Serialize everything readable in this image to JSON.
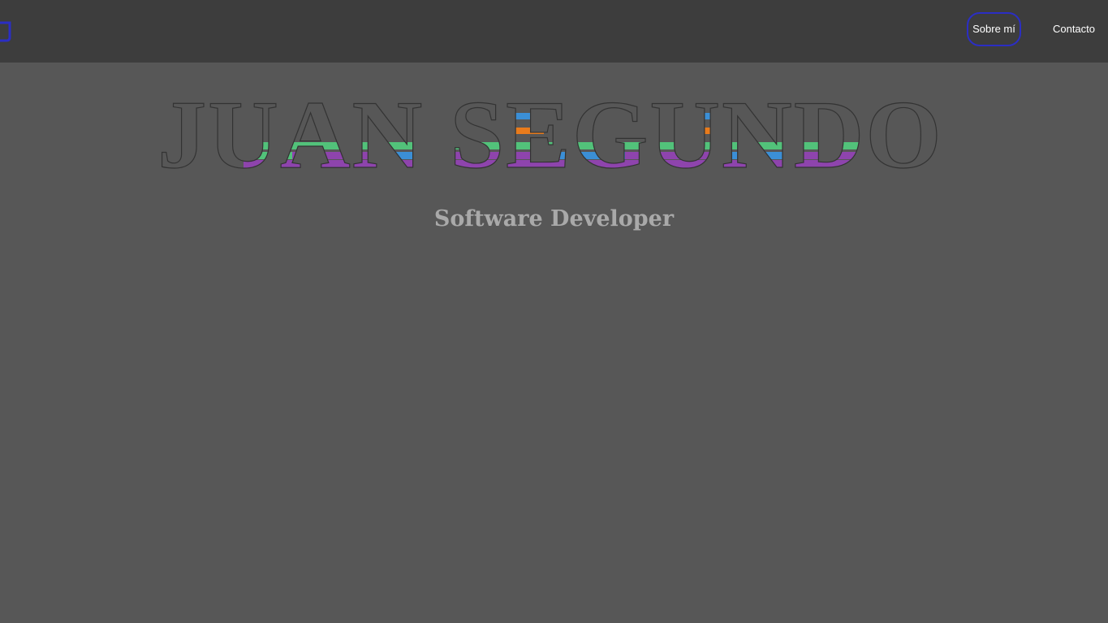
{
  "nav": {
    "logo_icon": "js-monogram-logo",
    "items": [
      {
        "label": "Sobre mí",
        "active": true
      },
      {
        "label": "Contacto",
        "active": false
      }
    ],
    "active_border_color": "#2b2ec4"
  },
  "hero": {
    "name": "JUAN SEGUNDO",
    "subtitle": "Software Developer",
    "stripe_colors": [
      "#3b8fd6",
      "#e87b1c",
      "#52c27a",
      "#8e44ad"
    ]
  },
  "colors": {
    "page_background": "#575757",
    "navbar_background": "#3d3d3d",
    "subtitle_color": "#a9a9a9"
  }
}
